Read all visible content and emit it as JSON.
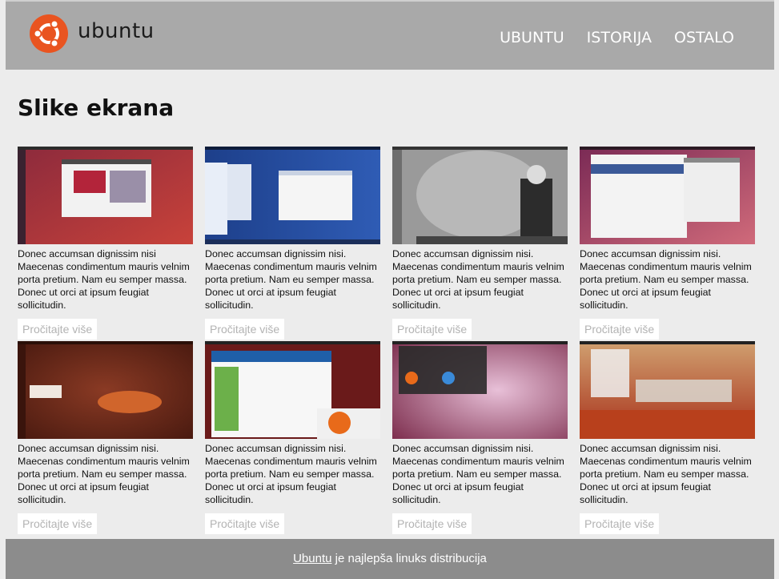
{
  "header": {
    "brand": "ubuntu",
    "nav": [
      "UBUNTU",
      "ISTORIJA",
      "OSTALO"
    ]
  },
  "page": {
    "title": "Slike ekrana"
  },
  "cards": [
    {
      "desc": "Donec accumsan dignissim nisi Maecenas condimentum mauris velnim porta pretium. Nam eu semper massa. Donec ut orci at ipsum feugiat sollicitudin.",
      "link": "Pročitajte više"
    },
    {
      "desc": "Donec accumsan dignissim nisi. Maecenas condimentum mauris velnim porta pretium. Nam eu semper massa. Donec ut orci at ipsum feugiat sollicitudin.",
      "link": "Pročitajte više"
    },
    {
      "desc": "Donec accumsan dignissim nisi. Maecenas condimentum mauris velnim porta pretium. Nam eu semper massa. Donec ut orci at ipsum feugiat sollicitudin.",
      "link": "Pročitajte više"
    },
    {
      "desc": "Donec accumsan dignissim nisi. Maecenas condimentum mauris velnim porta pretium. Nam eu semper massa. Donec ut orci at ipsum feugiat sollicitudin.",
      "link": "Pročitajte više"
    },
    {
      "desc": "Donec accumsan dignissim nisi. Maecenas condimentum mauris velnim porta pretium. Nam eu semper massa. Donec ut orci at ipsum feugiat sollicitudin.",
      "link": "Pročitajte više"
    },
    {
      "desc": "Donec accumsan dignissim nisi. Maecenas condimentum mauris velnim porta pretium. Nam eu semper massa. Donec ut orci at ipsum feugiat sollicitudin.",
      "link": "Pročitajte više"
    },
    {
      "desc": "Donec accumsan dignissim nisi. Maecenas condimentum mauris velnim porta pretium. Nam eu semper massa. Donec ut orci at ipsum feugiat sollicitudin.",
      "link": "Pročitajte više"
    },
    {
      "desc": "Donec accumsan dignissim nisi. Maecenas condimentum mauris velnim porta pretium. Nam eu semper massa. Donec ut orci at ipsum feugiat sollicitudin.",
      "link": "Pročitajte više"
    }
  ],
  "footer": {
    "link": "Ubuntu",
    "text": " je najlepša linuks distribucija"
  },
  "colors": {
    "brand_orange": "#e95420",
    "header_bg": "#a9a9a9",
    "footer_bg": "#8c8c8c"
  }
}
